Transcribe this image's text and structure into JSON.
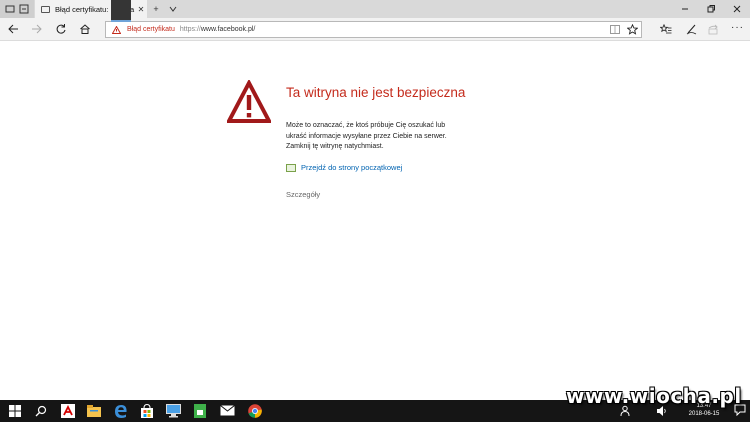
{
  "browser": {
    "tab": {
      "title": "Błąd certyfikatu: nawiga"
    },
    "address": {
      "cert_label": "Błąd certyfikatu",
      "url_scheme": "https://",
      "url_host": "www.facebook.pl/"
    }
  },
  "page": {
    "title": "Ta witryna nie jest bezpieczna",
    "body_line1": "Może to oznaczać, że ktoś próbuje Cię oszukać lub",
    "body_line2": "ukraść informacje wysyłane przez Ciebie na serwer.",
    "body_line3": "Zamknij tę witrynę natychmiast.",
    "home_link": "Przejdź do strony początkowej",
    "details": "Szczegóły"
  },
  "taskbar": {
    "clock_time": "13:47",
    "clock_date": "2018-06-15"
  },
  "watermark": "www.wiocha.pl",
  "colors": {
    "warning_red": "#c42b1c",
    "link_blue": "#0063b1",
    "taskbar": "#151515"
  },
  "icons": {
    "nav": [
      "back-arrow-icon",
      "forward-arrow-icon",
      "refresh-icon",
      "home-icon"
    ],
    "address_right": [
      "reading-view-icon",
      "favorite-star-icon"
    ],
    "toolbar": [
      "favorites-hub-icon",
      "pen-icon",
      "share-icon",
      "more-icon"
    ],
    "taskbar": [
      "windows-start-icon",
      "search-icon",
      "avira-icon",
      "file-explorer-icon",
      "edge-icon",
      "store-icon",
      "monitor-icon",
      "green-app-icon",
      "mail-icon",
      "chrome-icon"
    ]
  }
}
